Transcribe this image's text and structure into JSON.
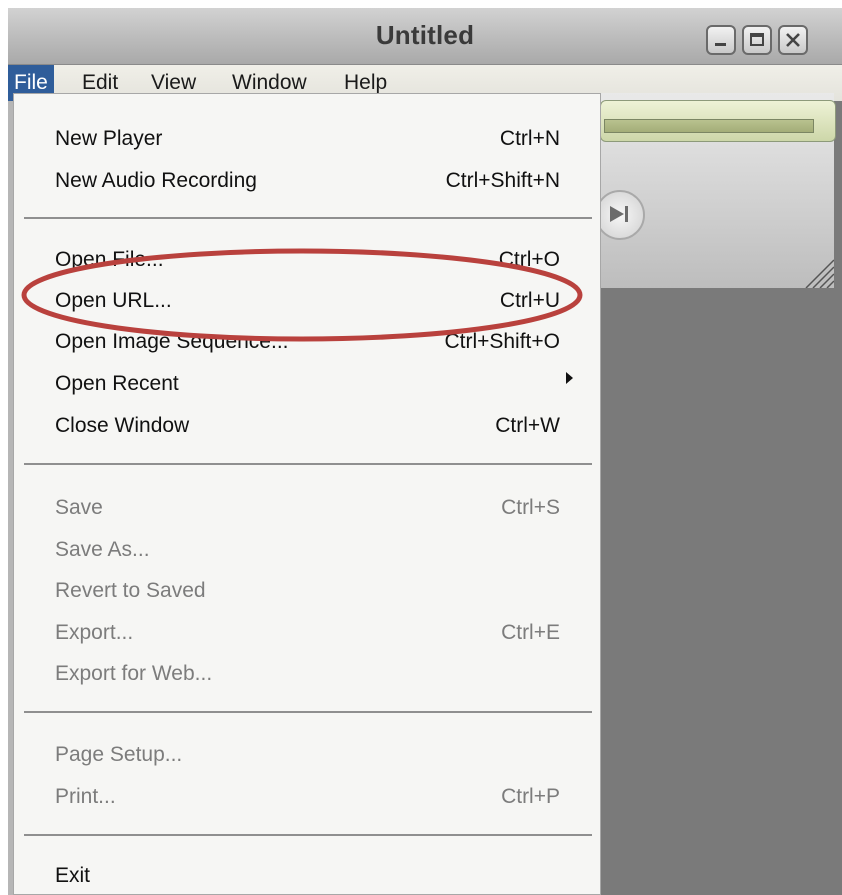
{
  "window": {
    "title": "Untitled"
  },
  "menubar": {
    "items": [
      "File",
      "Edit",
      "View",
      "Window",
      "Help"
    ],
    "active": "File"
  },
  "file_menu": {
    "new_player": {
      "label": "New Player",
      "shortcut": "Ctrl+N"
    },
    "new_audio_recording": {
      "label": "New Audio Recording",
      "shortcut": "Ctrl+Shift+N"
    },
    "open_file": {
      "label": "Open File...",
      "shortcut": "Ctrl+O"
    },
    "open_url": {
      "label": "Open URL...",
      "shortcut": "Ctrl+U"
    },
    "open_image_sequence": {
      "label": "Open Image Sequence...",
      "shortcut": "Ctrl+Shift+O"
    },
    "open_recent": {
      "label": "Open Recent"
    },
    "close_window": {
      "label": "Close Window",
      "shortcut": "Ctrl+W"
    },
    "save": {
      "label": "Save",
      "shortcut": "Ctrl+S",
      "enabled": false
    },
    "save_as": {
      "label": "Save As...",
      "enabled": false
    },
    "revert_to_saved": {
      "label": "Revert to Saved",
      "enabled": false
    },
    "export": {
      "label": "Export...",
      "shortcut": "Ctrl+E",
      "enabled": false
    },
    "export_for_web": {
      "label": "Export for Web...",
      "enabled": false
    },
    "page_setup": {
      "label": "Page Setup...",
      "enabled": false
    },
    "print": {
      "label": "Print...",
      "shortcut": "Ctrl+P",
      "enabled": false
    },
    "exit": {
      "label": "Exit"
    }
  },
  "annotation": {
    "color": "#b9413d",
    "highlighted_item": "Open URL..."
  },
  "colors": {
    "menu_highlight": "#2f5d9a",
    "menu_bg": "#f6f6f4",
    "disabled_text": "#7c7c7c"
  }
}
